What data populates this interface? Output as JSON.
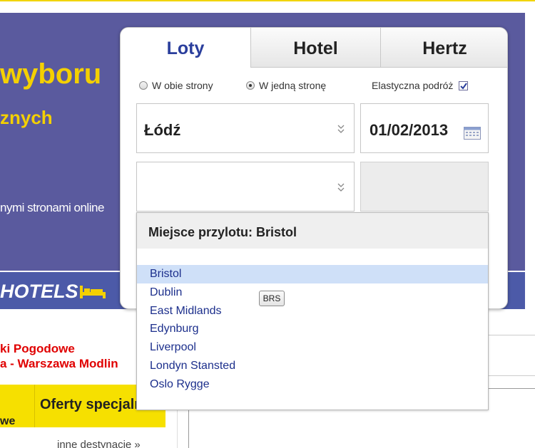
{
  "banner": {
    "headline": "wyboru",
    "subline": "znych",
    "tagline": "nymi stronami online",
    "hotels_logo": "HOTELS"
  },
  "tabs": [
    {
      "label": "Loty",
      "active": true
    },
    {
      "label": "Hotel",
      "active": false
    },
    {
      "label": "Hertz",
      "active": false
    }
  ],
  "trip_type": {
    "round_trip_label": "W obie strony",
    "one_way_label": "W jedną stronę",
    "selected": "one_way",
    "flexible_label": "Elastyczna podróż",
    "flexible_checked": true
  },
  "search": {
    "from_value": "Łódź",
    "departure_date": "01/02/2013",
    "to_value": "",
    "return_date": ""
  },
  "dropdown": {
    "title": "Miejsce przylotu: Bristol",
    "items": [
      "Bristol",
      "Dublin",
      "East Midlands",
      "Edynburg",
      "Liverpool",
      "Londyn Stansted",
      "Oslo Rygge"
    ],
    "selected_index": 0,
    "tooltip": "BRS"
  },
  "page": {
    "alert_line1": "ki Pogodowe",
    "alert_line2": "a - Warszawa Modlin",
    "left_col_label": "we",
    "offers_tab": "Oferty specjalne",
    "other_destinations": "inne destynacje »"
  },
  "colors": {
    "banner_bg": "#5a5a9e",
    "accent_yellow": "#f4d000",
    "tab_active_text": "#2a3e9c",
    "link_blue": "#1c2f8c",
    "alert_red": "#e00000",
    "selection_bg": "#cfe0f8"
  }
}
